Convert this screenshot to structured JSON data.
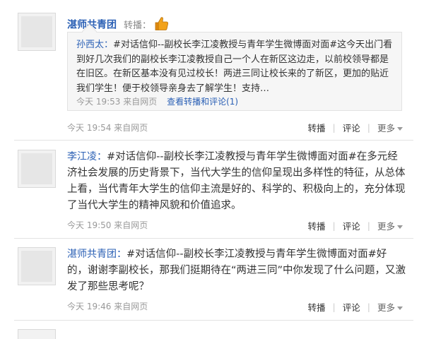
{
  "posts": [
    {
      "author": "湛师共青团",
      "repost_label": "转播：",
      "quote": {
        "author": "孙西太：",
        "text": "#对话信仰--副校长李江凌教授与青年学生微博面对面#这今天出门看到好几次我们的副校长李江凌教授自己一个人在新区这边走，以前校领导都是在旧区。在新区基本没有见过校长！两进三同让校长来的了新区，更加的贴近我们学生！便于校领导亲身去了解学生！支持…",
        "time": "今天 19:53",
        "source": "来自网页",
        "link": "查看转播和评论(1)"
      },
      "time": "今天 19:54",
      "source": "来自网页",
      "actions": {
        "repost": "转播",
        "comment": "评论",
        "more": "更多"
      }
    },
    {
      "author": "李江凌：",
      "text": "#对话信仰--副校长李江凌教授与青年学生微博面对面#在多元经济社会发展的历史背景下，当代大学生的信仰呈现出多样性的特征，从总体上看，当代青年大学生的信仰主流是好的、科学的、积极向上的，充分体现了当代大学生的精神风貌和价值追求。",
      "time": "今天 19:50",
      "source": "来自网页",
      "actions": {
        "repost": "转播",
        "comment": "评论",
        "more": "更多"
      }
    },
    {
      "author": "湛师共青团：",
      "text": "#对话信仰--副校长李江凌教授与青年学生微博面对面#好的，谢谢李副校长，那我们挺期待在“两进三同”中你发现了什么问题，又激发了那些思考呢？",
      "time": "今天 19:46",
      "source": "来自网页",
      "actions": {
        "repost": "转播",
        "comment": "评论",
        "more": "更多"
      }
    }
  ],
  "colors": {
    "name": "#2b60b5",
    "meta": "#999999",
    "divider": "#e3e3e3"
  },
  "icons": {
    "thumb": "thumbs-up-icon"
  }
}
